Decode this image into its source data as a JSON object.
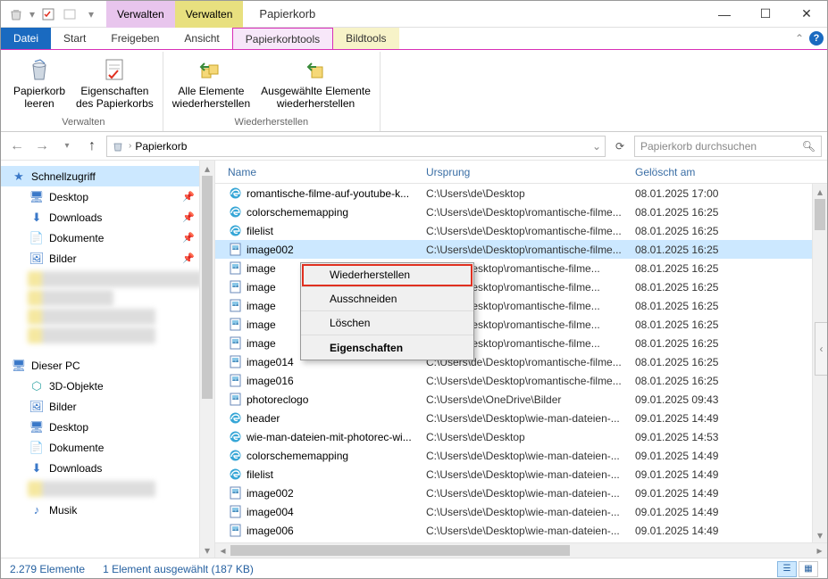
{
  "titlebar": {
    "context_tabs": [
      {
        "label": "Verwalten",
        "color": "pink"
      },
      {
        "label": "Verwalten",
        "color": "yellow"
      }
    ],
    "title": "Papierkorb"
  },
  "tabs": {
    "file": "Datei",
    "start": "Start",
    "freigeben": "Freigeben",
    "ansicht": "Ansicht",
    "papierkorbtools": "Papierkorbtools",
    "bildtools": "Bildtools"
  },
  "ribbon": {
    "group_manage": "Verwalten",
    "group_restore": "Wiederherstellen",
    "items": {
      "empty_bin_l1": "Papierkorb",
      "empty_bin_l2": "leeren",
      "props_l1": "Eigenschaften",
      "props_l2": "des Papierkorbs",
      "restore_all_l1": "Alle Elemente",
      "restore_all_l2": "wiederherstellen",
      "restore_sel_l1": "Ausgewählte Elemente",
      "restore_sel_l2": "wiederherstellen"
    }
  },
  "breadcrumb": {
    "location": "Papierkorb"
  },
  "search": {
    "placeholder": "Papierkorb durchsuchen"
  },
  "sidebar": {
    "quick_access": "Schnellzugriff",
    "desktop": "Desktop",
    "downloads": "Downloads",
    "dokumente": "Dokumente",
    "bilder": "Bilder",
    "this_pc": "Dieser PC",
    "objects3d": "3D-Objekte",
    "bilder2": "Bilder",
    "desktop2": "Desktop",
    "dokumente2": "Dokumente",
    "downloads2": "Downloads",
    "musik": "Musik"
  },
  "columns": {
    "name": "Name",
    "origin": "Ursprung",
    "deleted": "Gelöscht am"
  },
  "rows": [
    {
      "icon": "edge",
      "name": "romantische-filme-auf-youtube-k...",
      "origin": "C:\\Users\\de\\Desktop",
      "deleted": "08.01.2025 17:00"
    },
    {
      "icon": "edge",
      "name": "colorschememapping",
      "origin": "C:\\Users\\de\\Desktop\\romantische-filme...",
      "deleted": "08.01.2025 16:25"
    },
    {
      "icon": "edge",
      "name": "filelist",
      "origin": "C:\\Users\\de\\Desktop\\romantische-filme...",
      "deleted": "08.01.2025 16:25"
    },
    {
      "icon": "img",
      "name": "image002",
      "origin": "C:\\Users\\de\\Desktop\\romantische-filme...",
      "deleted": "08.01.2025 16:25",
      "selected": true
    },
    {
      "icon": "img",
      "name": "image",
      "origin": "sers\\de\\Desktop\\romantische-filme...",
      "deleted": "08.01.2025 16:25",
      "partial": true
    },
    {
      "icon": "img",
      "name": "image",
      "origin": "sers\\de\\Desktop\\romantische-filme...",
      "deleted": "08.01.2025 16:25",
      "partial": true
    },
    {
      "icon": "img",
      "name": "image",
      "origin": "sers\\de\\Desktop\\romantische-filme...",
      "deleted": "08.01.2025 16:25",
      "partial": true
    },
    {
      "icon": "img",
      "name": "image",
      "origin": "sers\\de\\Desktop\\romantische-filme...",
      "deleted": "08.01.2025 16:25",
      "partial": true
    },
    {
      "icon": "img",
      "name": "image",
      "origin": "sers\\de\\Desktop\\romantische-filme...",
      "deleted": "08.01.2025 16:25",
      "partial": true
    },
    {
      "icon": "img",
      "name": "image014",
      "origin": "C:\\Users\\de\\Desktop\\romantische-filme...",
      "deleted": "08.01.2025 16:25"
    },
    {
      "icon": "img",
      "name": "image016",
      "origin": "C:\\Users\\de\\Desktop\\romantische-filme...",
      "deleted": "08.01.2025 16:25"
    },
    {
      "icon": "img",
      "name": "photoreclogo",
      "origin": "C:\\Users\\de\\OneDrive\\Bilder",
      "deleted": "09.01.2025 09:43"
    },
    {
      "icon": "edge",
      "name": "header",
      "origin": "C:\\Users\\de\\Desktop\\wie-man-dateien-...",
      "deleted": "09.01.2025 14:49"
    },
    {
      "icon": "edge",
      "name": "wie-man-dateien-mit-photorec-wi...",
      "origin": "C:\\Users\\de\\Desktop",
      "deleted": "09.01.2025 14:53"
    },
    {
      "icon": "edge",
      "name": "colorschememapping",
      "origin": "C:\\Users\\de\\Desktop\\wie-man-dateien-...",
      "deleted": "09.01.2025 14:49"
    },
    {
      "icon": "edge",
      "name": "filelist",
      "origin": "C:\\Users\\de\\Desktop\\wie-man-dateien-...",
      "deleted": "09.01.2025 14:49"
    },
    {
      "icon": "img",
      "name": "image002",
      "origin": "C:\\Users\\de\\Desktop\\wie-man-dateien-...",
      "deleted": "09.01.2025 14:49"
    },
    {
      "icon": "img",
      "name": "image004",
      "origin": "C:\\Users\\de\\Desktop\\wie-man-dateien-...",
      "deleted": "09.01.2025 14:49"
    },
    {
      "icon": "img",
      "name": "image006",
      "origin": "C:\\Users\\de\\Desktop\\wie-man-dateien-...",
      "deleted": "09.01.2025 14:49"
    }
  ],
  "context_menu": {
    "restore": "Wiederherstellen",
    "cut": "Ausschneiden",
    "delete": "Löschen",
    "properties": "Eigenschaften"
  },
  "statusbar": {
    "count": "2.279 Elemente",
    "selection": "1 Element ausgewählt (187 KB)"
  }
}
